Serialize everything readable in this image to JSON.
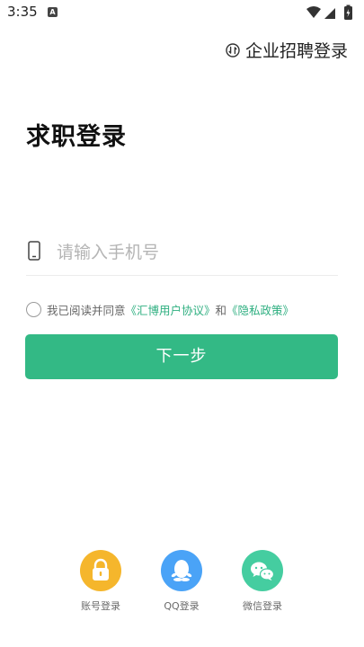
{
  "status_bar": {
    "time": "3:35",
    "notification_glyph": "A"
  },
  "header": {
    "enterprise_login": "企业招聘登录",
    "enterprise_icon": "swap-circle-icon"
  },
  "title": "求职登录",
  "phone": {
    "placeholder": "请输入手机号",
    "value": ""
  },
  "agreement": {
    "prefix": "我已阅读并同意",
    "user_agreement": "《汇博用户协议》",
    "and": "和",
    "privacy_policy": "《隐私政策》"
  },
  "next_button": "下一步",
  "login_options": [
    {
      "label": "账号登录",
      "icon": "lock-icon",
      "color": "#f5b62c"
    },
    {
      "label": "QQ登录",
      "icon": "qq-penguin-icon",
      "color": "#4aa3f7"
    },
    {
      "label": "微信登录",
      "icon": "wechat-icon",
      "color": "#45cda0"
    }
  ],
  "colors": {
    "accent": "#33b985",
    "link": "#2eaf80"
  }
}
